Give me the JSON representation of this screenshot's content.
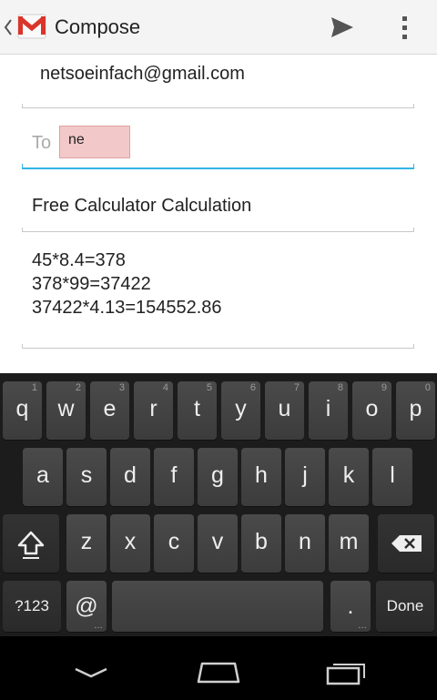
{
  "action_bar": {
    "title": "Compose",
    "icons": [
      "up-caret-icon",
      "gmail-logo-icon",
      "send-icon",
      "overflow-menu-icon"
    ]
  },
  "compose": {
    "from": "netsoeinfach@gmail.com",
    "to_label": "To",
    "to_chip": "ne",
    "subject": "Free Calculator Calculation",
    "body_lines": [
      "45*8.4=378",
      "378*99=37422",
      "37422*4.13=154552.86"
    ]
  },
  "keyboard": {
    "row1": [
      {
        "label": "q",
        "hint": "1"
      },
      {
        "label": "w",
        "hint": "2"
      },
      {
        "label": "e",
        "hint": "3"
      },
      {
        "label": "r",
        "hint": "4"
      },
      {
        "label": "t",
        "hint": "5"
      },
      {
        "label": "y",
        "hint": "6"
      },
      {
        "label": "u",
        "hint": "7"
      },
      {
        "label": "i",
        "hint": "8"
      },
      {
        "label": "o",
        "hint": "9"
      },
      {
        "label": "p",
        "hint": "0"
      }
    ],
    "row2": [
      "a",
      "s",
      "d",
      "f",
      "g",
      "h",
      "j",
      "k",
      "l"
    ],
    "row3": [
      "z",
      "x",
      "c",
      "v",
      "b",
      "n",
      "m"
    ],
    "symbols_label": "?123",
    "at_label": "@",
    "period_label": ".",
    "done_label": "Done",
    "icons": [
      "shift-icon",
      "backspace-icon"
    ]
  },
  "nav_bar": {
    "icons": [
      "back-icon",
      "home-icon",
      "recents-icon"
    ]
  },
  "colors": {
    "accent": "#33b5e5",
    "chip_background": "#f3c8c8",
    "keyboard_background": "#1c1c1c"
  }
}
